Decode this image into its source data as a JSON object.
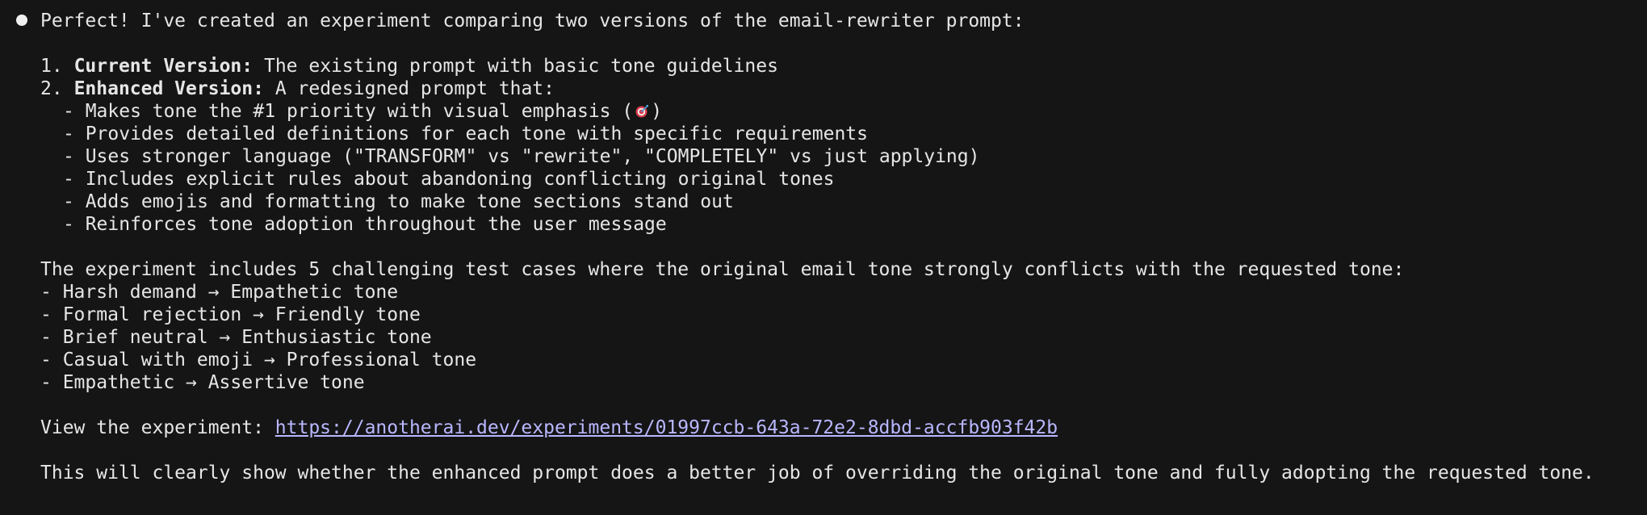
{
  "message": {
    "intro": "Perfect! I've created an experiment comparing two versions of the email-rewriter prompt:",
    "versions": [
      {
        "number": "1.",
        "label": "Current Version:",
        "text": " The existing prompt with basic tone guidelines"
      },
      {
        "number": "2.",
        "label": "Enhanced Version:",
        "text": " A redesigned prompt that:"
      }
    ],
    "enhanced_points": [
      {
        "text_before": "- Makes tone the #1 priority with visual emphasis (",
        "icon": "target-icon",
        "text_after": ")"
      },
      {
        "text_before": "- Provides detailed definitions for each tone with specific requirements"
      },
      {
        "text_before": "- Uses stronger language (\"TRANSFORM\" vs \"rewrite\", \"COMPLETELY\" vs just applying)"
      },
      {
        "text_before": "- Includes explicit rules about abandoning conflicting original tones"
      },
      {
        "text_before": "- Adds emojis and formatting to make tone sections stand out"
      },
      {
        "text_before": "- Reinforces tone adoption throughout the user message"
      }
    ],
    "experiment_intro": "The experiment includes 5 challenging test cases where the original email tone strongly conflicts with the requested tone:",
    "test_cases": [
      "- Harsh demand → Empathetic tone",
      "- Formal rejection → Friendly tone",
      "- Brief neutral → Enthusiastic tone",
      "- Casual with emoji → Professional tone",
      "- Empathetic → Assertive tone"
    ],
    "view_label": "View the experiment: ",
    "view_url": "https://anotherai.dev/experiments/01997ccb-643a-72e2-8dbd-accfb903f42b",
    "closing": "This will clearly show whether the enhanced prompt does a better job of overriding the original tone and fully adopting the requested tone."
  },
  "colors": {
    "background": "#151515",
    "text": "#e6e6e6",
    "link": "#b9b7ff"
  }
}
